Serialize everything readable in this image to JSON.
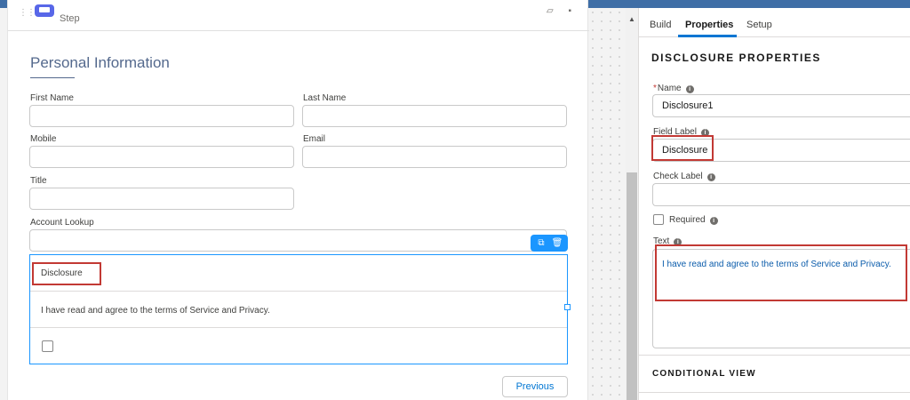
{
  "canvas": {
    "step_label": "Step",
    "section_title": "Personal Information",
    "fields": {
      "first_name": "First Name",
      "last_name": "Last Name",
      "mobile": "Mobile",
      "email": "Email",
      "title": "Title",
      "account_lookup": "Account Lookup"
    },
    "disclosure": {
      "label": "Disclosure",
      "text": "I have read and agree to the terms of Service and Privacy."
    },
    "previous_button": "Previous"
  },
  "panel": {
    "tabs": [
      "Build",
      "Properties",
      "Setup"
    ],
    "active_tab": "Properties",
    "heading": "DISCLOSURE PROPERTIES",
    "name_label": "Name",
    "name_value": "Disclosure1",
    "field_label_label": "Field Label",
    "field_label_value": "Disclosure",
    "check_label_label": "Check Label",
    "check_label_value": "",
    "required_label": "Required",
    "text_label": "Text",
    "text_value": "I have read and agree to the terms of Service and Privacy.",
    "conditional_view": "CONDITIONAL VIEW"
  },
  "colors": {
    "accent": "#0176d3",
    "highlight": "#c23934",
    "selection": "#1b96ff"
  }
}
